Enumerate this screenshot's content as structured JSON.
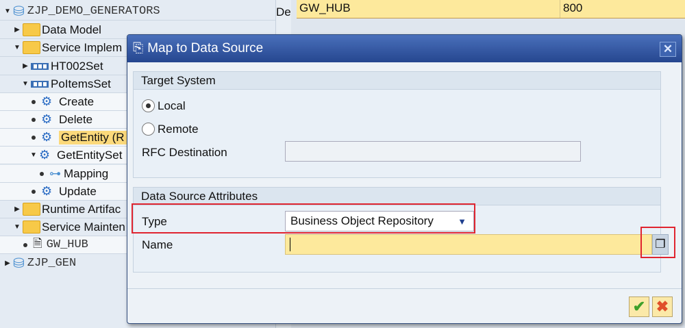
{
  "tree": {
    "items": [
      {
        "label": "ZJP_DEMO_GENERATORS",
        "icon": "service-project-icon"
      },
      {
        "label": "Data Model",
        "icon": "folder-icon"
      },
      {
        "label": "Service Implem",
        "icon": "folder-open-icon"
      },
      {
        "label": "HT002Set",
        "icon": "entity-set-icon"
      },
      {
        "label": "PoItemsSet",
        "icon": "entity-set-icon"
      },
      {
        "label": "Create",
        "icon": "operation-icon"
      },
      {
        "label": "Delete",
        "icon": "operation-icon"
      },
      {
        "label": "GetEntity (R",
        "icon": "operation-icon"
      },
      {
        "label": "GetEntitySet",
        "icon": "operation-icon"
      },
      {
        "label": "Mapping",
        "icon": "mapping-icon"
      },
      {
        "label": "Update",
        "icon": "operation-icon"
      },
      {
        "label": "Runtime Artifac",
        "icon": "folder-icon"
      },
      {
        "label": "Service Mainten",
        "icon": "folder-open-icon"
      },
      {
        "label": "GW_HUB",
        "icon": "document-icon"
      },
      {
        "label": "ZJP_GEN",
        "icon": "project-icon"
      }
    ]
  },
  "detail": {
    "col_label": "De",
    "system": "GW_HUB",
    "client": "800"
  },
  "dialog": {
    "title": "Map to Data Source",
    "target_system": {
      "heading": "Target System",
      "local": "Local",
      "remote": "Remote",
      "selected": "Local",
      "rfc_label": "RFC Destination",
      "rfc_value": ""
    },
    "attributes": {
      "heading": "Data Source Attributes",
      "type_label": "Type",
      "type_value": "Business Object Repository",
      "name_label": "Name",
      "name_value": ""
    },
    "ok_icon": "checkmark-icon",
    "cancel_icon": "cancel-x-icon"
  },
  "colors": {
    "title_bar": "#2f52a0",
    "highlight": "#fbd97b",
    "required_field": "#fde99c",
    "annotation": "#e0242f"
  }
}
